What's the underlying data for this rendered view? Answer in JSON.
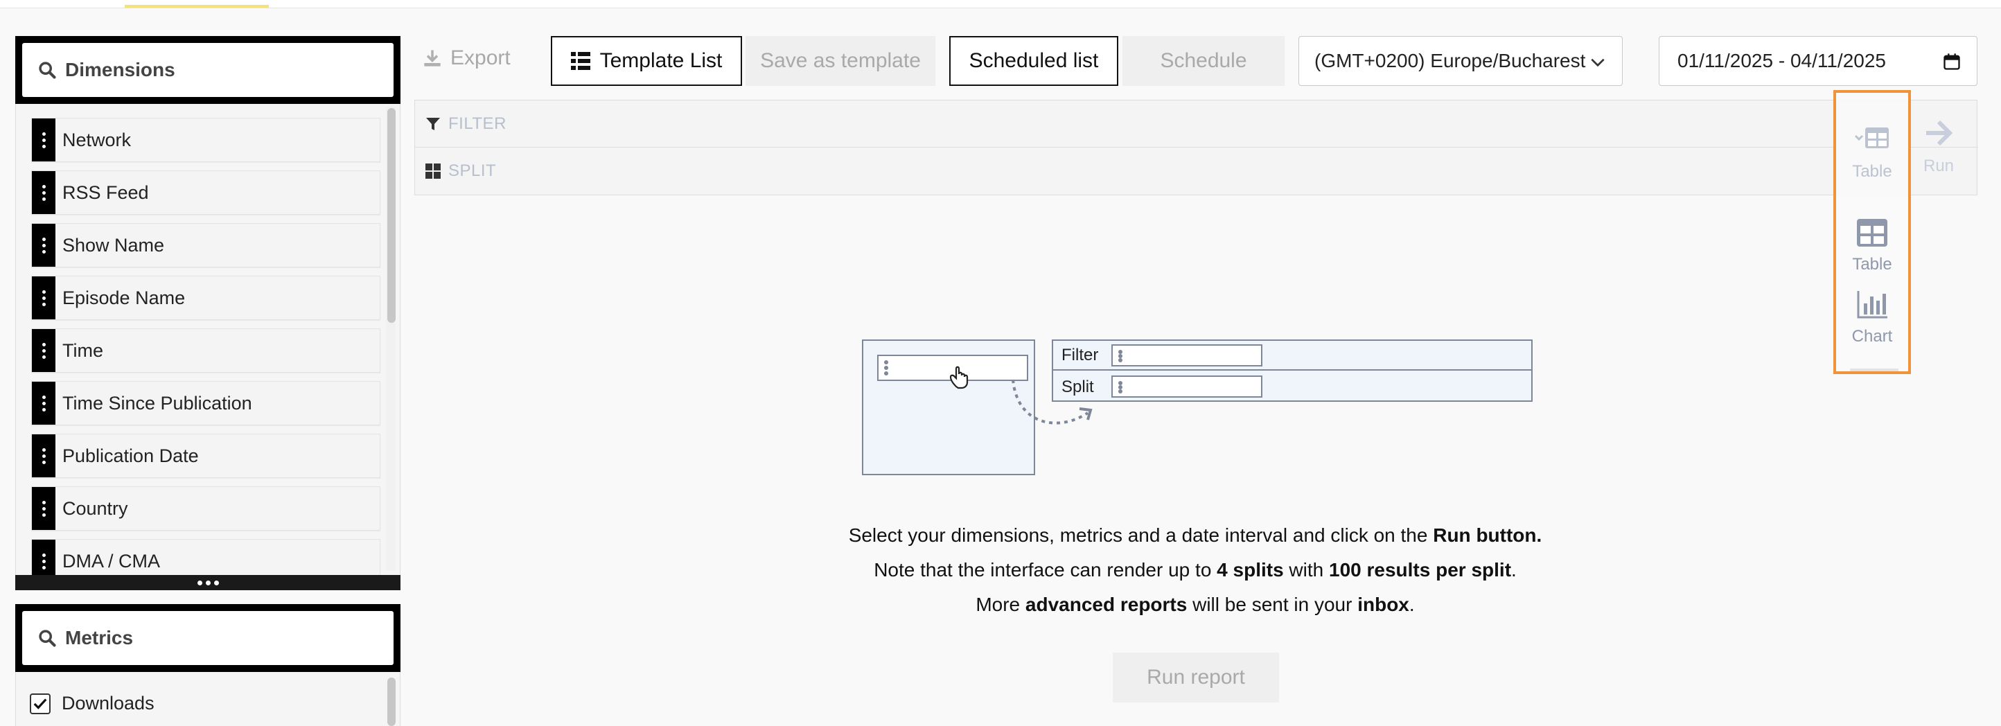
{
  "dimensions": {
    "search_label": "Dimensions",
    "items": [
      {
        "label": "Network"
      },
      {
        "label": "RSS Feed"
      },
      {
        "label": "Show Name"
      },
      {
        "label": "Episode Name"
      },
      {
        "label": "Time"
      },
      {
        "label": "Time Since Publication"
      },
      {
        "label": "Publication Date"
      },
      {
        "label": "Country"
      },
      {
        "label": "DMA / CMA"
      }
    ]
  },
  "metrics": {
    "search_label": "Metrics",
    "items": [
      {
        "label": "Downloads",
        "checked": true
      }
    ]
  },
  "toolbar": {
    "export_label": "Export",
    "template_list_label": "Template List",
    "save_template_label": "Save as template",
    "scheduled_list_label": "Scheduled list",
    "schedule_label": "Schedule",
    "timezone_value": "(GMT+0200) Europe/Bucharest",
    "date_range_value": "01/11/2025 - 04/11/2025"
  },
  "filters": {
    "filter_label": "FILTER",
    "split_label": "SPLIT"
  },
  "visualization": {
    "current_label": "Table",
    "options": [
      {
        "label": "Table",
        "icon": "table-icon"
      },
      {
        "label": "Chart",
        "icon": "bar-chart-icon"
      }
    ],
    "run_label": "Run"
  },
  "illustration": {
    "filter_label": "Filter",
    "split_label": "Split"
  },
  "info": {
    "line1_pre": "Select your dimensions, metrics and a date interval and click on the ",
    "line1_bold": "Run button.",
    "line2_pre": "Note that the interface can render up to ",
    "line2_bold1": "4 splits",
    "line2_mid": " with ",
    "line2_bold2": "100 results per split",
    "line2_post": ".",
    "line3_pre": "More ",
    "line3_bold1": "advanced reports",
    "line3_mid": " will be sent in your ",
    "line3_bold2": "inbox",
    "line3_post": "."
  },
  "run_report_label": "Run report",
  "colors": {
    "highlight": "#f0943c",
    "dark": "#000000",
    "muted_icon": "#8f98ab",
    "accent_tab": "#f4e27a"
  }
}
